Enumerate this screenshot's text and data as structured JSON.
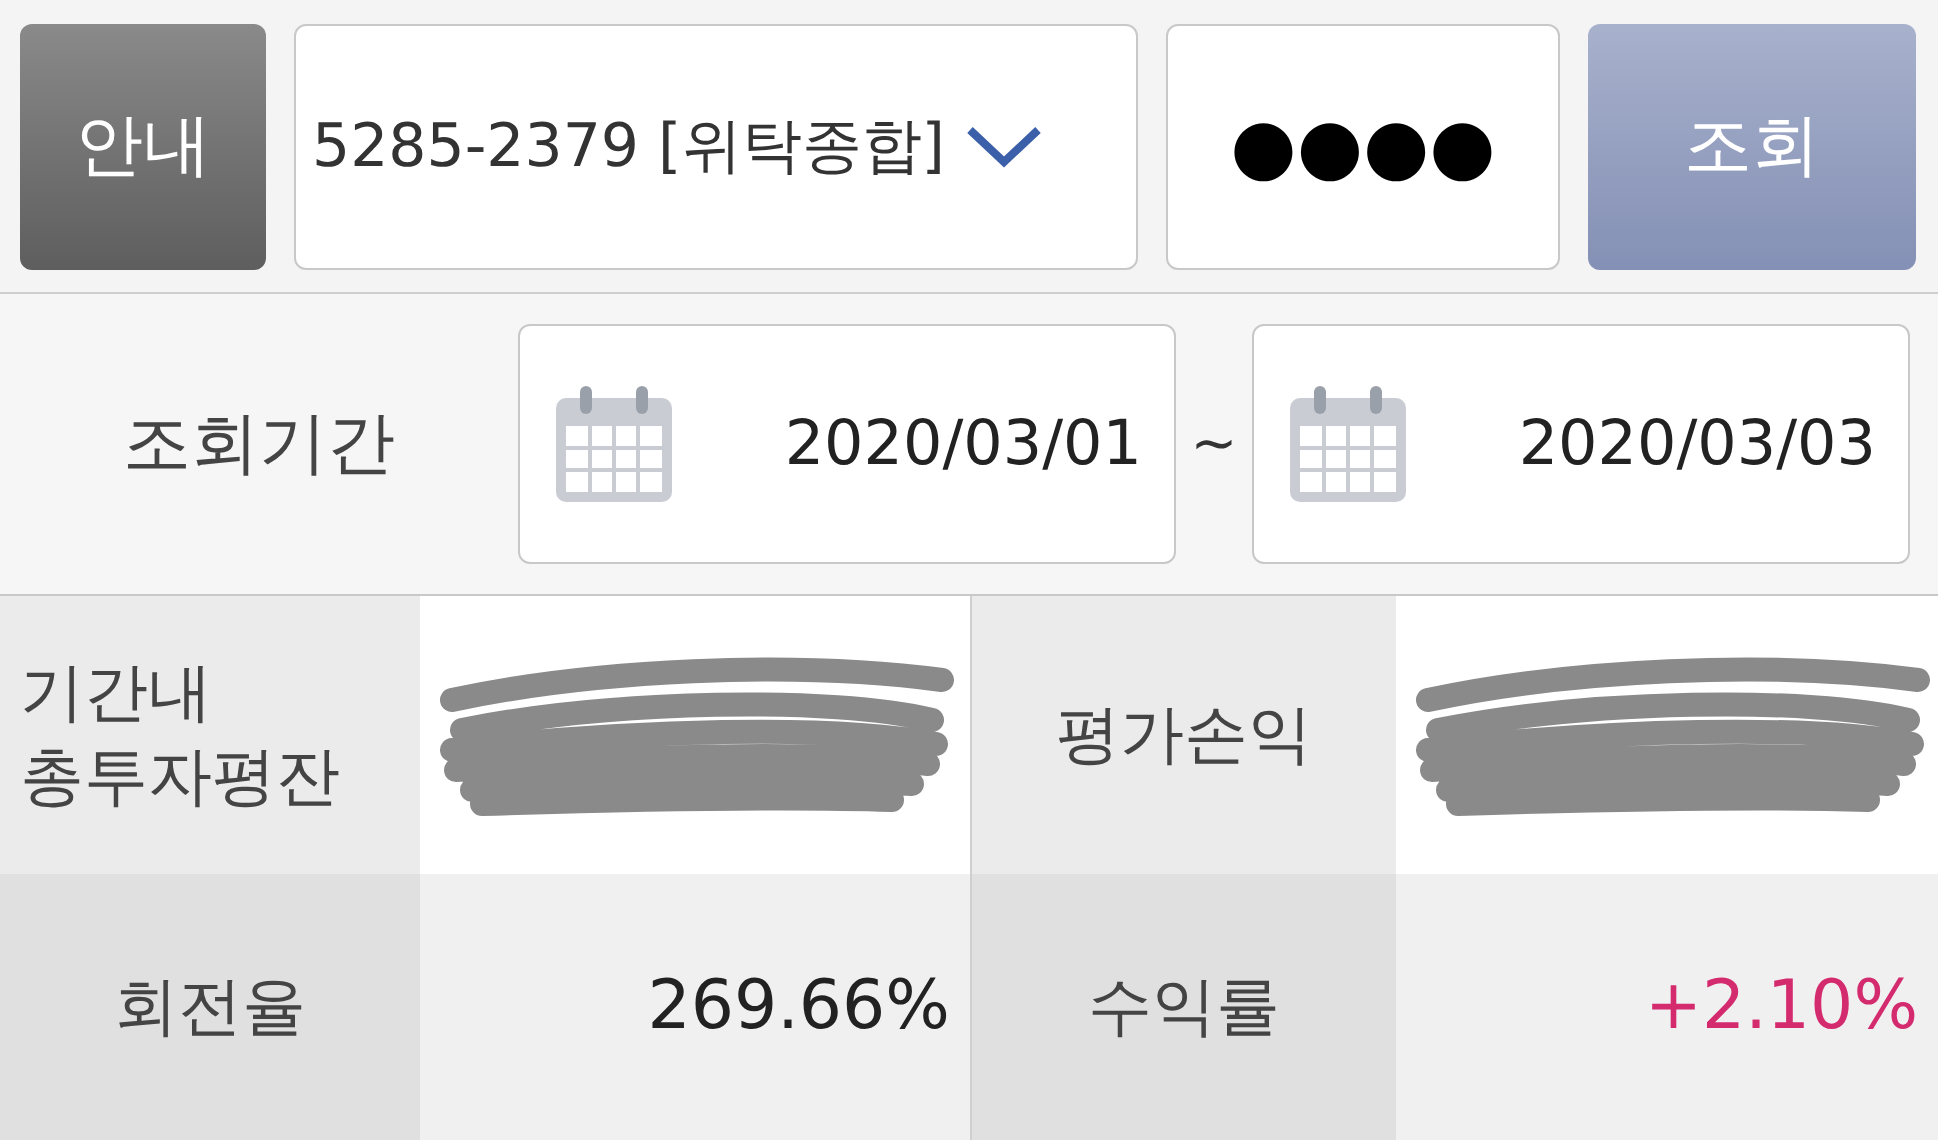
{
  "toolbar": {
    "info_button": "안내",
    "account": {
      "value": "5285-2379 [위탁종합]"
    },
    "password": {
      "value": "●●●●"
    },
    "search_button": "조회"
  },
  "period": {
    "label": "조회기간",
    "start": "2020/03/01",
    "separator": "~",
    "end": "2020/03/03"
  },
  "summary": [
    {
      "label": "기간내\n총투자평잔",
      "redacted": true
    },
    {
      "label": "평가손익",
      "redacted": true
    },
    {
      "label": "회전율",
      "redacted": false,
      "value": "269.66%",
      "color": "#222222"
    },
    {
      "label": "수익률",
      "redacted": false,
      "value": "+2.10%",
      "color": "#d42a6e"
    }
  ]
}
